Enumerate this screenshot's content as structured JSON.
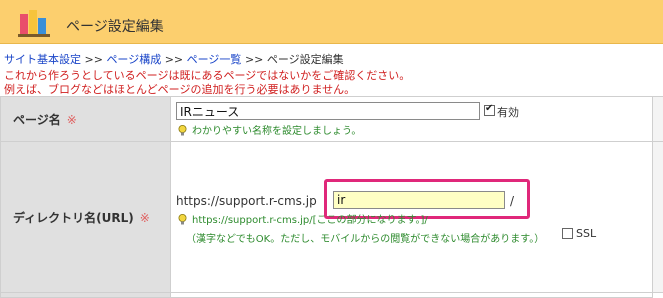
{
  "header": {
    "title": "ページ設定編集"
  },
  "breadcrumb": {
    "items": [
      "サイト基本設定",
      "ページ構成",
      "ページ一覧"
    ],
    "separator": ">>",
    "current": "ページ設定編集"
  },
  "notice": {
    "line1": "これから作ろうとしているページは既にあるページではないかをご確認ください。",
    "line2": "例えば、ブログなどはほとんどページの追加を行う必要はありません。"
  },
  "form": {
    "page_name": {
      "label": "ページ名",
      "required_mark": "※",
      "value": "IRニュース",
      "enabled_label": "有効",
      "enabled": true,
      "hint": "わかりやすい名称を設定しましょう。"
    },
    "directory": {
      "label": "ディレクトリ名(URL)",
      "required_mark": "※",
      "url_prefix": "https://support.r-cms.jp",
      "value": "ir",
      "slash": "/",
      "hint": "https://support.r-cms.jp/[ここの部分になります。]/",
      "note": "（漢字などでもOK。ただし、モバイルからの閲覧ができない場合があります。）",
      "ssl_label": "SSL",
      "ssl": false
    }
  },
  "colors": {
    "header_bg": "#fccf6e",
    "highlight": "#e0287a",
    "required": "#e06060",
    "hint": "#2e8b2e",
    "notice": "#d02020"
  }
}
